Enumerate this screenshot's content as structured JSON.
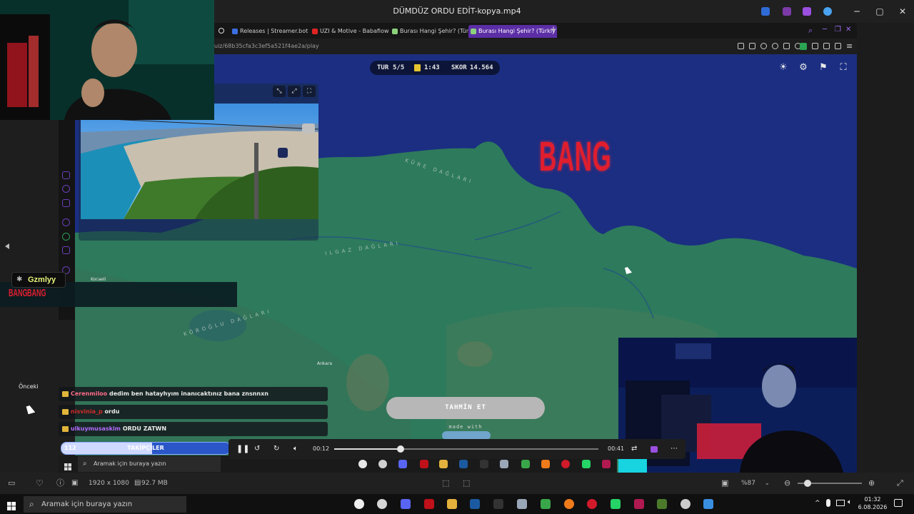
{
  "window": {
    "title": "DÜMDÜZ ORDU EDİT-kopya.mp4"
  },
  "browser": {
    "tabs": [
      {
        "label": "Releases | Streamer.bot"
      },
      {
        "label": "UZI & Motive - Babafiow"
      },
      {
        "label": "Burası Hangi Şehir? (Türkiy"
      },
      {
        "label": "Burası Hangi Şehir? (Türkiy"
      }
    ],
    "url": "uiz/68b35cfa3c3ef5a521f4ae2a/play"
  },
  "game": {
    "hud": {
      "round_label": "TUR",
      "round_value": "5/5",
      "timer": "1:43",
      "score_label": "SKOR",
      "score_value": "14.564"
    },
    "bang_text": "BANG",
    "guess_button": "TAHMİN ET",
    "made_with": "made with",
    "map_places": {
      "kocaeli": "Kocaeli",
      "ankara": "Ankara"
    }
  },
  "overlay": {
    "badge_name": "Gzmlyy",
    "alert_text": "BANG",
    "previous_tooltip": "Önceki",
    "chat": [
      {
        "user": "Cerenmiloo",
        "message": "dedim ben hatayhyım inanıcaktınız bana znsnnxn",
        "color": "#ff6b8a"
      },
      {
        "user": "nisvinia_p",
        "message": "ordu",
        "color": "#d12a2a"
      },
      {
        "user": "ulkuymusaskim",
        "message": "ORDU ZATWN",
        "color": "#b36cff"
      }
    ],
    "followers": {
      "count": "112",
      "label": "TAKİPÇİLER",
      "progress_pct": 54
    }
  },
  "player": {
    "elapsed": "00:12",
    "duration": "00:41",
    "progress_pct": 25,
    "resolution": "1920 x 1080",
    "file_size": "92.7 MB",
    "zoom": "%87",
    "zoom_pct": 15
  },
  "inner_taskbar": {
    "search_placeholder": "Aramak için buraya yazın"
  },
  "taskbar": {
    "search_placeholder": "Aramak için buraya yazın",
    "time": "01:32",
    "date": "6.08.2026"
  },
  "colors": {
    "accent": "#5b2ea6",
    "ocean": "#1b2e82",
    "land": "#2e7a5c"
  }
}
